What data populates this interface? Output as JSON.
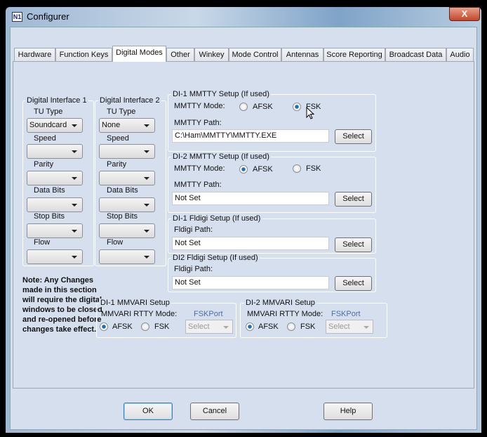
{
  "window": {
    "title": "Configurer",
    "close": "X",
    "logo": "N1"
  },
  "tabs": [
    "Hardware",
    "Function Keys",
    "Digital Modes",
    "Other",
    "Winkey",
    "Mode Control",
    "Antennas",
    "Score Reporting",
    "Broadcast Data",
    "Audio"
  ],
  "active_tab": "Digital Modes",
  "di1": {
    "title": "Digital Interface 1",
    "tu_label": "TU Type",
    "tu_value": "Soundcard",
    "speed": "Speed",
    "parity": "Parity",
    "data_bits": "Data Bits",
    "stop_bits": "Stop Bits",
    "flow": "Flow"
  },
  "di2": {
    "title": "Digital Interface 2",
    "tu_label": "TU Type",
    "tu_value": "None",
    "speed": "Speed",
    "parity": "Parity",
    "data_bits": "Data Bits",
    "stop_bits": "Stop Bits",
    "flow": "Flow"
  },
  "mmtty1": {
    "title": "DI-1 MMTTY Setup (If used)",
    "mode_label": "MMTTY Mode:",
    "afsk": "AFSK",
    "fsk": "FSK",
    "selected": "FSK",
    "path_label": "MMTTY Path:",
    "path": "C:\\Ham\\MMTTY\\MMTTY.EXE",
    "select": "Select"
  },
  "mmtty2": {
    "title": "DI-2 MMTTY Setup (If used)",
    "mode_label": "MMTTY Mode:",
    "afsk": "AFSK",
    "fsk": "FSK",
    "selected": "AFSK",
    "path_label": "MMTTY Path:",
    "path": "Not Set",
    "select": "Select"
  },
  "fldigi1": {
    "title": "DI-1 Fldigi Setup (If used)",
    "path_label": "Fldigi Path:",
    "path": "Not Set",
    "select": "Select"
  },
  "fldigi2": {
    "title": "DI2 Fldigi Setup (If used)",
    "path_label": "Fldigi Path:",
    "path": "Not Set",
    "select": "Select"
  },
  "note": "Note: Any Changes made in this section will require the digital windows to be closed and re-opened before changes take effect.",
  "mmvari1": {
    "title": "DI-1 MMVARI Setup",
    "mode_label": "MMVARI RTTY Mode:",
    "port_label": "FSKPort",
    "afsk": "AFSK",
    "fsk": "FSK",
    "selected": "AFSK",
    "port": "Select"
  },
  "mmvari2": {
    "title": "DI-2 MMVARI Setup",
    "mode_label": "MMVARI RTTY Mode:",
    "port_label": "FSKPort",
    "afsk": "AFSK",
    "fsk": "FSK",
    "selected": "AFSK",
    "port": "Select"
  },
  "buttons": {
    "ok": "OK",
    "cancel": "Cancel",
    "help": "Help"
  }
}
